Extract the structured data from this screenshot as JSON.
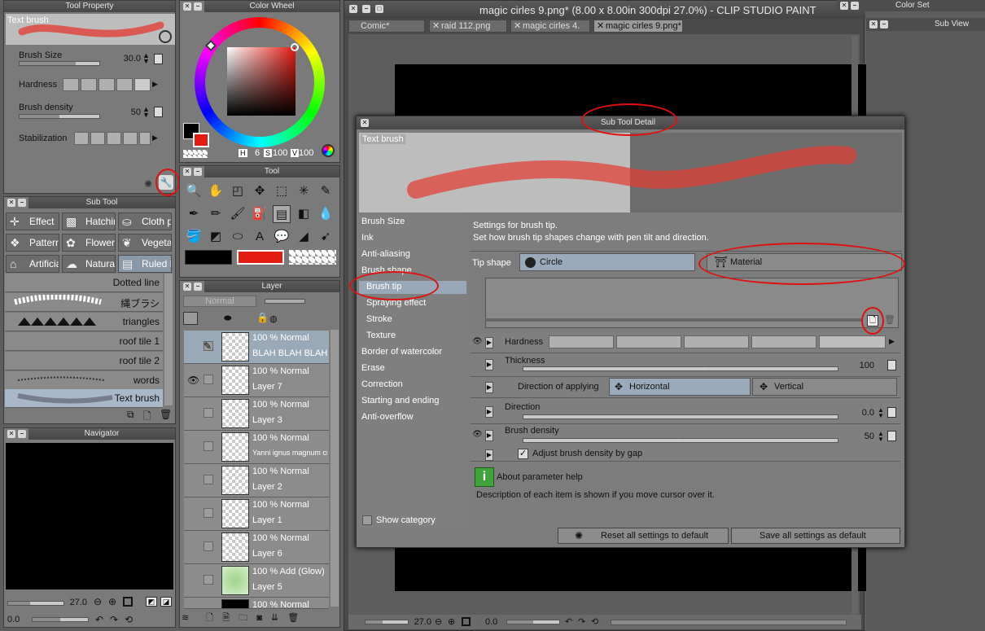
{
  "window": {
    "title": "magic cirles 9.png* (8.00 x 8.00in 300dpi 27.0%)  - CLIP STUDIO PAINT",
    "tabs": [
      {
        "label": "Comic*",
        "active": false
      },
      {
        "label": "raid 112.png",
        "active": false
      },
      {
        "label": "magic cirles 4.",
        "active": false
      },
      {
        "label": "magic cirles 9.png*",
        "active": true
      }
    ],
    "zoom": "27.0",
    "angle": "0.0"
  },
  "tool_property": {
    "title": "Tool Property",
    "preview_label": "Text brush",
    "brush_size_label": "Brush Size",
    "brush_size_value": "30.0",
    "hardness_label": "Hardness",
    "density_label": "Brush density",
    "density_value": "50",
    "stabilization_label": "Stabilization"
  },
  "color_wheel": {
    "title": "Color Wheel",
    "h_label": "H",
    "h_value": "6",
    "s_label": "S",
    "s_value": "100",
    "v_label": "V",
    "v_value": "100",
    "main_color": "#e41b12",
    "sub_color": "#000000"
  },
  "tool": {
    "title": "Tool"
  },
  "sub_tool": {
    "title": "Sub Tool",
    "groups": [
      "Effect",
      "Hatchin",
      "Cloth p",
      "Pattern",
      "Flower",
      "Vegetat",
      "Artificia",
      "Natural",
      "Ruled li"
    ],
    "brushes": [
      "Dotted line",
      "縄ブラシ",
      "triangles",
      "roof tile 1",
      "roof tile 2",
      "words",
      "Text brush"
    ]
  },
  "navigator": {
    "title": "Navigator",
    "zoom": "27.0",
    "angle": "0.0"
  },
  "layer": {
    "title": "Layer",
    "blend_mode": "Normal",
    "rows": [
      {
        "mode": "100 % Normal",
        "name": "BLAH BLAH BLAH BLA"
      },
      {
        "mode": "100 % Normal",
        "name": "Layer 7"
      },
      {
        "mode": "100 % Normal",
        "name": "Layer 3"
      },
      {
        "mode": "100 % Normal",
        "name": "Yanni ignus magnum cr"
      },
      {
        "mode": "100 % Normal",
        "name": "Layer 2"
      },
      {
        "mode": "100 % Normal",
        "name": "Layer 1"
      },
      {
        "mode": "100 % Normal",
        "name": "Layer 6"
      },
      {
        "mode": "100 % Add (Glow)",
        "name": "Layer 5"
      },
      {
        "mode": "100 % Normal",
        "name": ""
      }
    ]
  },
  "right_panels": {
    "color_set": "Color Set",
    "sub_view": "Sub View"
  },
  "dialog": {
    "title": "Sub Tool Detail",
    "preview_label": "Text brush",
    "categories": [
      "Brush Size",
      "Ink",
      "Anti-aliasing",
      "Brush shape",
      "Brush tip",
      "Spraying effect",
      "Stroke",
      "Texture",
      "Border of watercolor",
      "Erase",
      "Correction",
      "Starting and ending",
      "Anti-overflow"
    ],
    "selected_category": "Brush tip",
    "show_category": "Show category",
    "desc_line1": "Settings for brush tip.",
    "desc_line2": "Set how brush tip shapes change with pen tilt and direction.",
    "tip_shape_label": "Tip shape",
    "tip_circle": "Circle",
    "tip_material": "Material",
    "hardness_label": "Hardness",
    "thickness_label": "Thickness",
    "thickness_value": "100",
    "direction_applying_label": "Direction of applying",
    "dir_horizontal": "Horizontal",
    "dir_vertical": "Vertical",
    "direction_label": "Direction",
    "direction_value": "0.0",
    "density_label": "Brush density",
    "density_value": "50",
    "adjust_label": "Adjust brush density by gap",
    "help_title": "About parameter help",
    "help_desc": "Description of each item is shown if you move cursor over it.",
    "reset_label": "Reset all settings to default",
    "save_label": "Save all settings as default"
  }
}
